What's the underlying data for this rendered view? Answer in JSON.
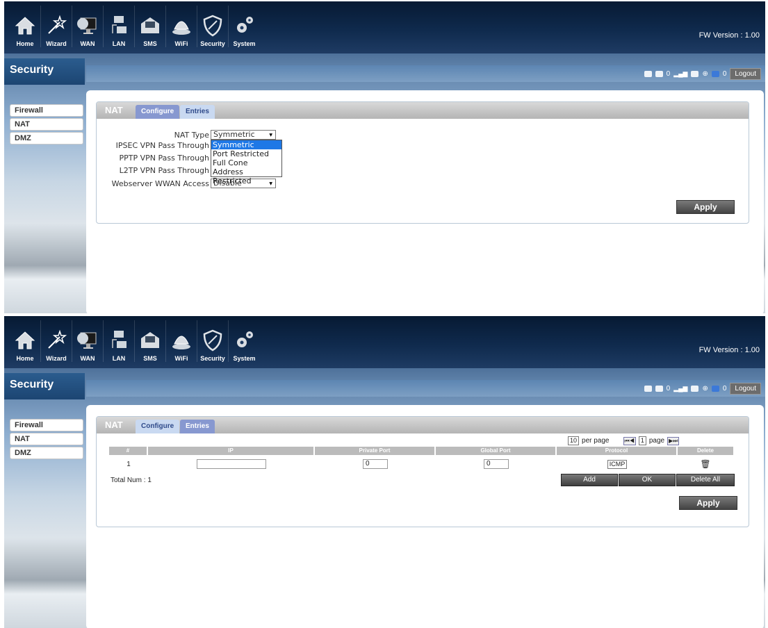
{
  "nav": {
    "items": [
      {
        "label": "Home",
        "icon": "home-icon"
      },
      {
        "label": "Wizard",
        "icon": "wand-icon"
      },
      {
        "label": "WAN",
        "icon": "globe-monitor-icon"
      },
      {
        "label": "LAN",
        "icon": "computer-icon"
      },
      {
        "label": "SMS",
        "icon": "envelope-icon"
      },
      {
        "label": "WiFi",
        "icon": "wifi-router-icon"
      },
      {
        "label": "Security",
        "icon": "shield-icon"
      },
      {
        "label": "System",
        "icon": "gears-icon"
      }
    ],
    "fw_version": "FW Version : 1.00"
  },
  "section_title": "Security",
  "status_bar": {
    "sms_count": "0",
    "msg_count": "0",
    "logout_label": "Logout"
  },
  "sidebar": {
    "items": [
      "Firewall",
      "NAT",
      "DMZ"
    ]
  },
  "tabs": {
    "header": "NAT",
    "configure": "Configure",
    "entries": "Entries"
  },
  "configure_form": {
    "nat_type_label": "NAT Type",
    "nat_type_value": "Symmetric",
    "ipsec_label": "IPSEC VPN Pass Through",
    "pptp_label": "PPTP VPN Pass Through",
    "l2tp_label": "L2TP VPN Pass Through",
    "webserver_label": "Webserver WWAN Access",
    "webserver_value": "Disable",
    "dropdown_options": [
      "Symmetric",
      "Port Restricted",
      "Full Cone",
      "Address Restricted"
    ],
    "apply_label": "Apply"
  },
  "entries": {
    "per_page_value": "10",
    "per_page_label": "per page",
    "page_value": "1",
    "page_label": "page",
    "columns": [
      "#",
      "IP",
      "Private Port",
      "Global Port",
      "Protocol",
      "Delete"
    ],
    "rows": [
      {
        "num": "1",
        "ip": "",
        "private_port": "0",
        "global_port": "0",
        "protocol": "ICMP"
      }
    ],
    "total": "Total Num : 1",
    "add_label": "Add",
    "ok_label": "OK",
    "delete_all_label": "Delete All",
    "apply_label": "Apply"
  },
  "colors": {
    "header_dark": "#0f2a4d",
    "tab_active": "#c9d9f1",
    "tab_inactive": "#8798d0",
    "selected_option": "#1e78e6"
  }
}
